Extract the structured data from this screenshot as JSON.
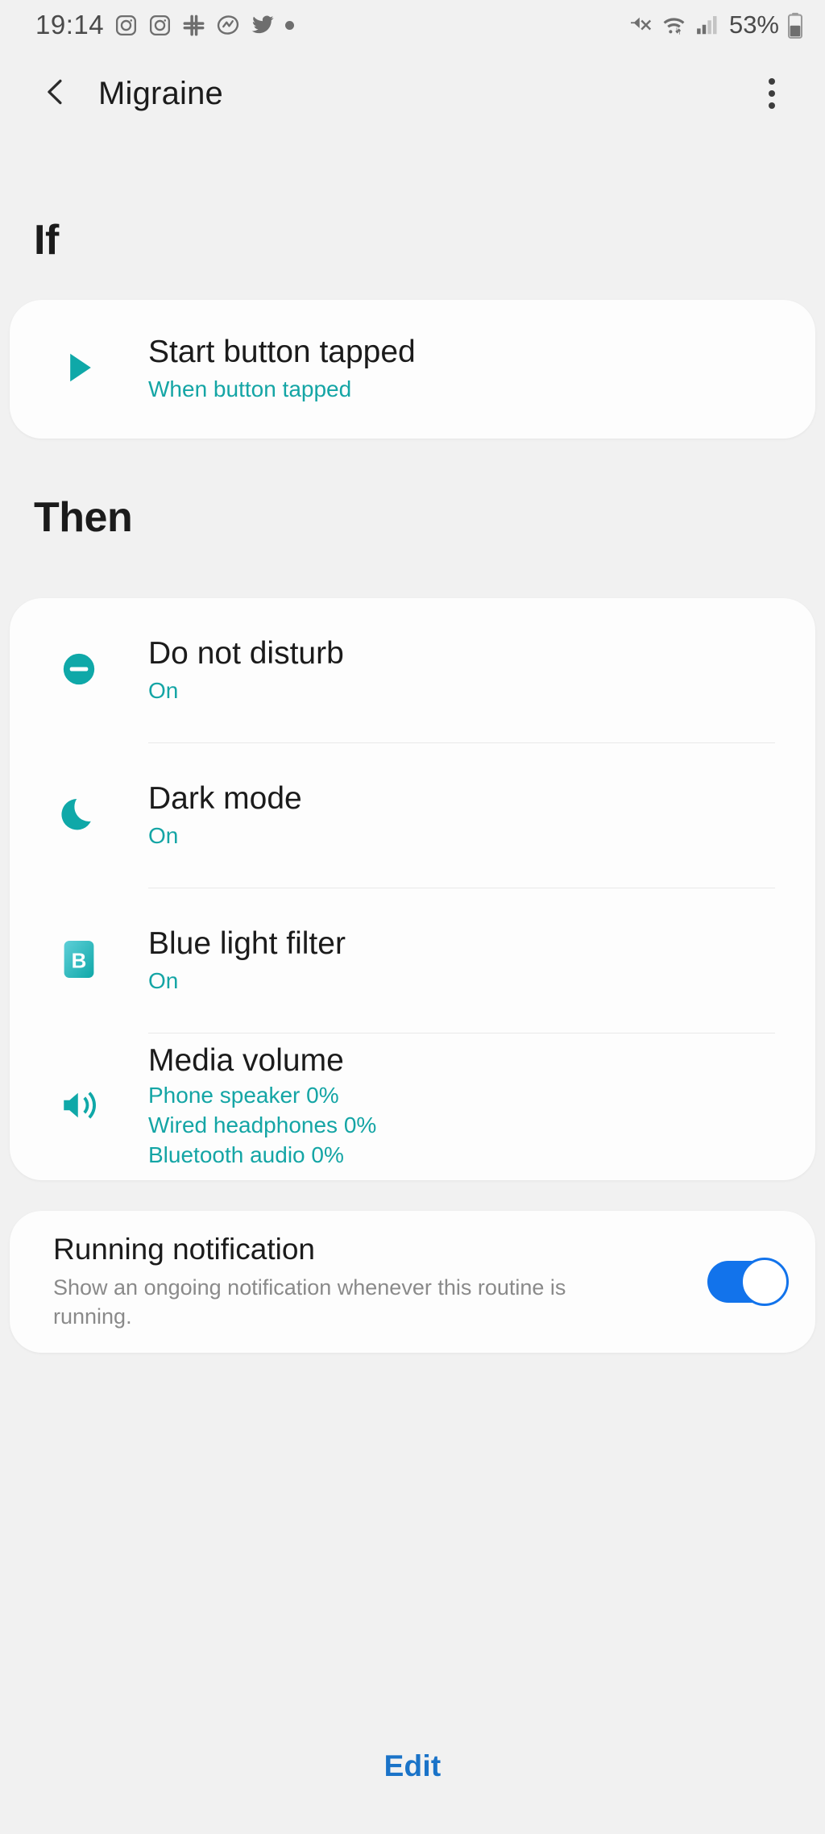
{
  "statusbar": {
    "time": "19:14",
    "battery_percent": "53%",
    "left_icons": [
      "instagram-icon",
      "instagram-icon",
      "slack-icon",
      "basecamp-icon",
      "twitter-icon",
      "dot-icon"
    ],
    "right_icons": [
      "mute-icon",
      "wifi-transfer-icon",
      "signal-bars-icon",
      "battery-icon"
    ],
    "text_color": "#4a4a4a"
  },
  "titlebar": {
    "back_icon": "chevron-left-icon",
    "title": "Migraine",
    "more_icon": "more-vertical-icon"
  },
  "colors": {
    "background": "#f1f1f1",
    "card": "#fdfdfd",
    "accent_teal": "#14a5a5",
    "toggle_blue": "#1273eb",
    "edit_blue": "#1a73c8",
    "title_dark": "#1b1b1b",
    "muted_gray": "#8a8a8a"
  },
  "sections": {
    "if": {
      "heading": "If",
      "trigger": {
        "icon": "play-triangle-icon",
        "title": "Start button tapped",
        "subtitle": "When button tapped"
      }
    },
    "then": {
      "heading": "Then",
      "actions": [
        {
          "icon": "do-not-disturb-icon",
          "title": "Do not disturb",
          "subtitle": "On"
        },
        {
          "icon": "crescent-moon-icon",
          "title": "Dark mode",
          "subtitle": "On"
        },
        {
          "icon": "blue-light-filter-icon",
          "title": "Blue light filter",
          "subtitle": "On"
        },
        {
          "icon": "speaker-volume-icon",
          "title": "Media volume",
          "subtitles": [
            "Phone speaker 0%",
            "Wired headphones 0%",
            "Bluetooth audio 0%"
          ]
        }
      ]
    }
  },
  "running_notification": {
    "title": "Running notification",
    "description": "Show an ongoing notification whenever this routine is running.",
    "toggle_state": "on"
  },
  "footer": {
    "edit_label": "Edit"
  }
}
